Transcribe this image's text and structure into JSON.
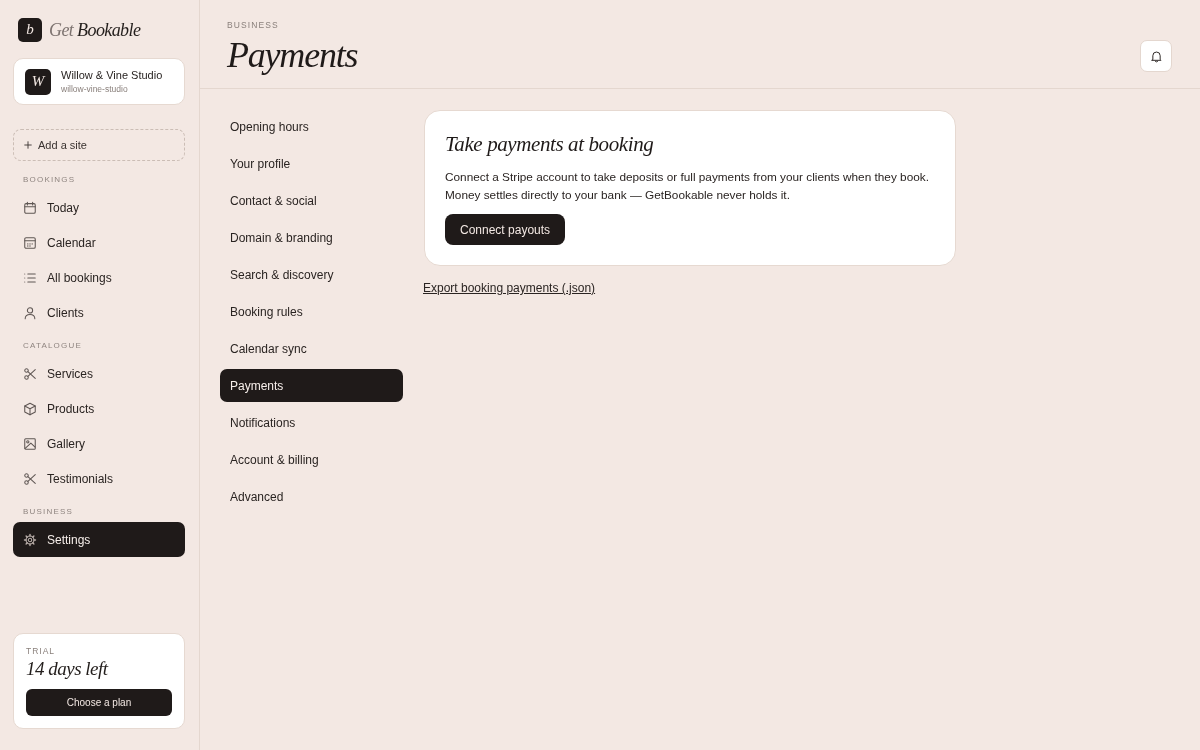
{
  "brand": {
    "mark": "b",
    "words": [
      "Get",
      "Bookable"
    ]
  },
  "site": {
    "initial": "W",
    "name": "Willow & Vine Studio",
    "slug": "willow-vine-studio"
  },
  "add_site": {
    "label": "Add a site"
  },
  "sidebar": {
    "sections": [
      {
        "title": "BOOKINGS",
        "items": [
          {
            "label": "Today",
            "kind": "today",
            "selected": false
          },
          {
            "label": "Calendar",
            "kind": "calendar",
            "selected": false
          },
          {
            "label": "All bookings",
            "kind": "bookings",
            "selected": false
          },
          {
            "label": "Clients",
            "kind": "clients",
            "selected": false
          }
        ]
      },
      {
        "title": "CATALOGUE",
        "items": [
          {
            "label": "Services",
            "kind": "services",
            "selected": false
          },
          {
            "label": "Products",
            "kind": "products",
            "selected": false
          },
          {
            "label": "Gallery",
            "kind": "gallery",
            "selected": false
          },
          {
            "label": "Testimonials",
            "kind": "testimonials",
            "selected": false
          }
        ]
      },
      {
        "title": "BUSINESS",
        "items": [
          {
            "label": "Settings",
            "kind": "settings",
            "selected": true
          }
        ]
      }
    ]
  },
  "trial": {
    "label": "TRIAL",
    "days_left": "14 days left",
    "button": "Choose a plan"
  },
  "header": {
    "eyebrow": "BUSINESS",
    "title": "Payments"
  },
  "settings_nav": {
    "items": [
      {
        "label": "Opening hours",
        "selected": false
      },
      {
        "label": "Your profile",
        "selected": false
      },
      {
        "label": "Contact & social",
        "selected": false
      },
      {
        "label": "Domain & branding",
        "selected": false
      },
      {
        "label": "Search & discovery",
        "selected": false
      },
      {
        "label": "Booking rules",
        "selected": false
      },
      {
        "label": "Calendar sync",
        "selected": false
      },
      {
        "label": "Payments",
        "selected": true
      },
      {
        "label": "Notifications",
        "selected": false
      },
      {
        "label": "Account & billing",
        "selected": false
      },
      {
        "label": "Advanced",
        "selected": false
      }
    ]
  },
  "payments": {
    "card": {
      "title": "Take payments at booking",
      "description": "Connect a Stripe account to take deposits or full payments from your clients when they book. Money settles directly to your bank — GetBookable never holds it.",
      "button": "Connect payouts"
    },
    "export_link": "Export booking payments (.json)"
  }
}
